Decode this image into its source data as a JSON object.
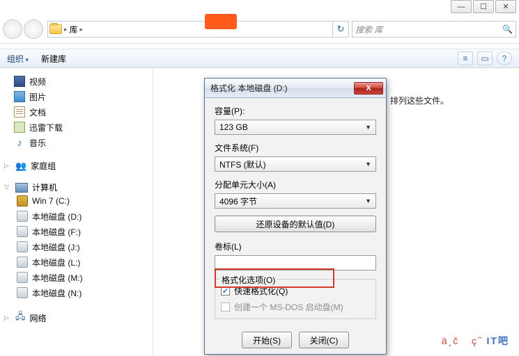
{
  "window_controls": {
    "min": "—",
    "max": "☐",
    "close": "✕"
  },
  "breadcrumb": {
    "root": "库",
    "sep": "▸"
  },
  "refresh_glyph": "↻",
  "search": {
    "placeholder": "搜索 库",
    "icon": "🔍"
  },
  "orange_button": "",
  "toolbar2": {
    "organize": "组织",
    "newlib": "新建库",
    "icons": {
      "view": "≡",
      "preview": "▭",
      "help": "?"
    }
  },
  "main_hint": "排列这些文件。",
  "nav": {
    "libs": [
      {
        "icon": "film",
        "label": "视频"
      },
      {
        "icon": "pic",
        "label": "图片"
      },
      {
        "icon": "doc",
        "label": "文档"
      },
      {
        "icon": "dl",
        "label": "迅雷下载"
      },
      {
        "icon": "music",
        "label": "音乐"
      }
    ],
    "homegroup": "家庭组",
    "computer": "计算机",
    "drives": [
      {
        "icon": "win",
        "label": "Win 7 (C:)"
      },
      {
        "icon": "drive",
        "label": "本地磁盘 (D:)"
      },
      {
        "icon": "drive",
        "label": "本地磁盘 (F:)"
      },
      {
        "icon": "drive",
        "label": "本地磁盘 (J:)"
      },
      {
        "icon": "drive",
        "label": "本地磁盘 (L:)"
      },
      {
        "icon": "drive",
        "label": "本地磁盘 (M:)"
      },
      {
        "icon": "drive",
        "label": "本地磁盘 (N:)"
      }
    ],
    "network": "网络"
  },
  "dialog": {
    "title": "格式化 本地磁盘 (D:)",
    "capacity_label": "容量(P):",
    "capacity_value": "123 GB",
    "fs_label": "文件系统(F)",
    "fs_value": "NTFS (默认)",
    "alloc_label": "分配单元大小(A)",
    "alloc_value": "4096 字节",
    "restore": "还原设备的默认值(D)",
    "volume_label": "卷标(L)",
    "volume_value": "",
    "options_label": "格式化选项(O)",
    "quick": "快速格式化(Q)",
    "msdos": "创建一个 MS-DOS 启动盘(M)",
    "start": "开始(S)",
    "close": "关闭(C)"
  },
  "watermark": {
    "a": "ä¸č",
    "b": "ç˝",
    "c": "IT吧"
  }
}
